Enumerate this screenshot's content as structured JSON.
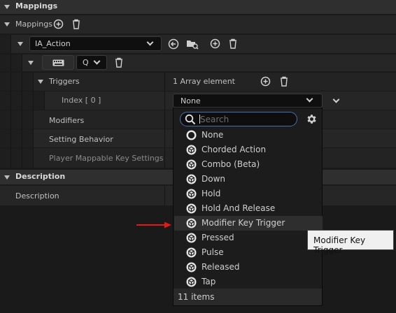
{
  "panel": {
    "mappings_header": "Mappings",
    "mappings_label": "Mappings",
    "action_select": "IA_Action",
    "key_value": "Q",
    "triggers_label": "Triggers",
    "triggers_value": "1 Array element",
    "index_label": "Index [ 0 ]",
    "index_value": "None",
    "modifiers_label": "Modifiers",
    "setting_behavior_label": "Setting Behavior",
    "player_mappable_label": "Player Mappable Key Settings",
    "description_header": "Description",
    "description_label": "Description"
  },
  "dropdown": {
    "search_placeholder": "Search",
    "items": [
      {
        "label": "None",
        "icon": "circle-icon"
      },
      {
        "label": "Chorded Action",
        "icon": "class-icon"
      },
      {
        "label": "Combo (Beta)",
        "icon": "class-icon"
      },
      {
        "label": "Down",
        "icon": "class-icon"
      },
      {
        "label": "Hold",
        "icon": "class-icon"
      },
      {
        "label": "Hold And Release",
        "icon": "class-icon"
      },
      {
        "label": "Modifier Key Trigger",
        "icon": "class-icon",
        "hovered": true
      },
      {
        "label": "Pressed",
        "icon": "class-icon"
      },
      {
        "label": "Pulse",
        "icon": "class-icon"
      },
      {
        "label": "Released",
        "icon": "class-icon"
      },
      {
        "label": "Tap",
        "icon": "class-icon"
      }
    ],
    "count": "11 items"
  },
  "tooltip": "Modifier Key Trigger",
  "colors": {
    "annotation_arrow": "#e01b1b",
    "search_focus": "#4c6fa8"
  }
}
